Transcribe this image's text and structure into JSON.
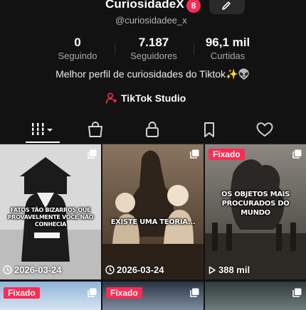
{
  "profile": {
    "display_name": "CuriosidadeX",
    "notification_count": "8",
    "handle": "@curiosidadee_x",
    "stats": [
      {
        "value": "0",
        "label": "Seguindo"
      },
      {
        "value": "7.187",
        "label": "Seguidores"
      },
      {
        "value": "96,1 mil",
        "label": "Curtidas"
      }
    ],
    "bio": "Melhor perfil de curiosidades do Tiktok✨👽",
    "studio_label": "TikTok Studio"
  },
  "tabs": [
    {
      "icon": "grid-icon"
    },
    {
      "icon": "shop-bag-icon"
    },
    {
      "icon": "lock-icon"
    },
    {
      "icon": "bookmark-icon"
    },
    {
      "icon": "heart-icon"
    }
  ],
  "videos": [
    {
      "pinned": false,
      "overlay": "FATOS TÃO BIZARROS QUE PROVAVELMENTE VOCÊ NÃO CONHECIA",
      "footer": "2026-03-24",
      "footer_icon": "clock-icon"
    },
    {
      "pinned": false,
      "overlay": "EXISTE UMA TEORIA...",
      "footer": "2026-03-24",
      "footer_icon": "clock-icon"
    },
    {
      "pinned": true,
      "pinned_label": "Fixado",
      "overlay": "OS OBJETOS MAIS PROCURADOS DO MUNDO",
      "footer": "388 mil",
      "footer_icon": "play-icon"
    },
    {
      "pinned": true,
      "pinned_label": "Fixado"
    },
    {
      "pinned": true,
      "pinned_label": "Fixado"
    },
    {
      "pinned": false
    }
  ],
  "colors": {
    "accent": "#fe2c55",
    "background": "#121212"
  }
}
